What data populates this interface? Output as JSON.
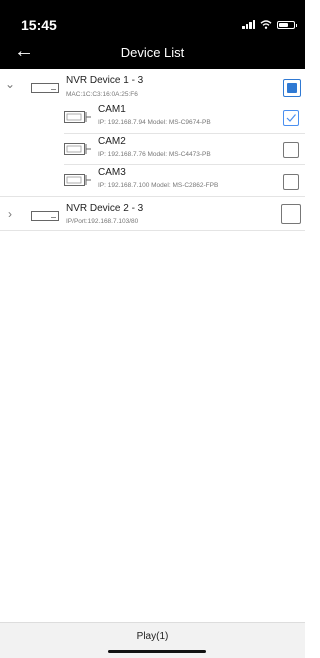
{
  "status": {
    "time": "15:45"
  },
  "header": {
    "title": "Device List"
  },
  "devices": [
    {
      "name": "NVR Device 1 - 3",
      "sub": "MAC:1C:C3:16:0A:25:F6",
      "expanded": true,
      "check": "partial"
    },
    {
      "name": "NVR Device 2 - 3",
      "sub": "IP/Port:192.168.7.103/80",
      "expanded": false,
      "check": "none"
    }
  ],
  "cameras": [
    {
      "name": "CAM1",
      "info": "IP: 192.168.7.94 Model: MS-C9674-PB",
      "checked": true
    },
    {
      "name": "CAM2",
      "info": "IP: 192.168.7.76 Model: MS-C4473-PB",
      "checked": false
    },
    {
      "name": "CAM3",
      "info": "IP: 192.168.7.100 Model: MS-C2862-FPB",
      "checked": false
    }
  ],
  "footer": {
    "play_label": "Play(1)"
  },
  "colors": {
    "header_bg": "#000000",
    "checkbox_accent": "#2f79d3"
  }
}
